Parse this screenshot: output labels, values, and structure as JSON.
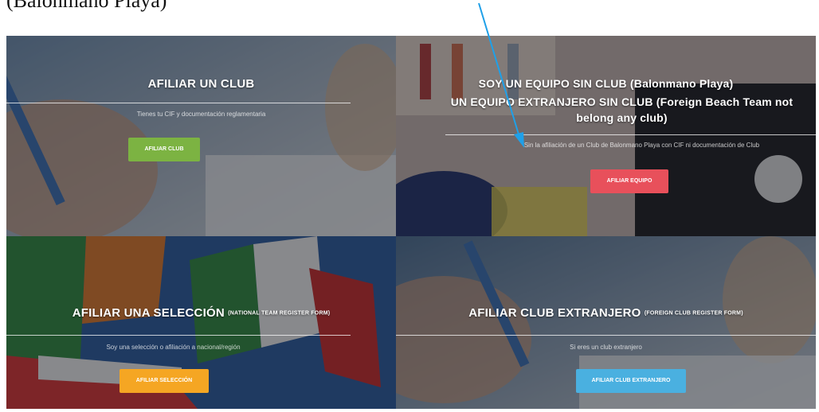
{
  "caption": "(Balonmano Playa)",
  "panels": {
    "club": {
      "title": "AFILIAR UN CLUB",
      "subtitle": "Tienes tu CIF y documentación reglamentaria",
      "button": "AFILIAR CLUB",
      "button_color": "#7cb342"
    },
    "team": {
      "title_line1": "SOY UN EQUIPO SIN CLUB (Balonmano Playa)",
      "title_line2": "UN EQUIPO EXTRANJERO SIN CLUB (Foreign Beach Team not belong any club)",
      "subtitle": "Sin la afiliación de un Club de Balonmano Playa con CIF ni documentación de Club",
      "button": "AFILIAR EQUIPO",
      "button_color": "#e8505b"
    },
    "selection": {
      "title": "AFILIAR UNA SELECCIÓN",
      "title_small": "(NATIONAL TEAM REGISTER FORM)",
      "subtitle": "Soy una selección o afiliación a nacional/región",
      "button": "AFILIAR SELECCIÓN",
      "button_color": "#f5a623"
    },
    "foreign": {
      "title": "AFILIAR CLUB EXTRANJERO",
      "title_small": "(FOREIGN CLUB REGISTER FORM)",
      "subtitle": "Si eres un club extranjero",
      "button": "AFILIAR CLUB EXTRANJERO",
      "button_color": "#4ab0e0"
    }
  },
  "annotation": {
    "arrow_color": "#1fa0e8"
  }
}
